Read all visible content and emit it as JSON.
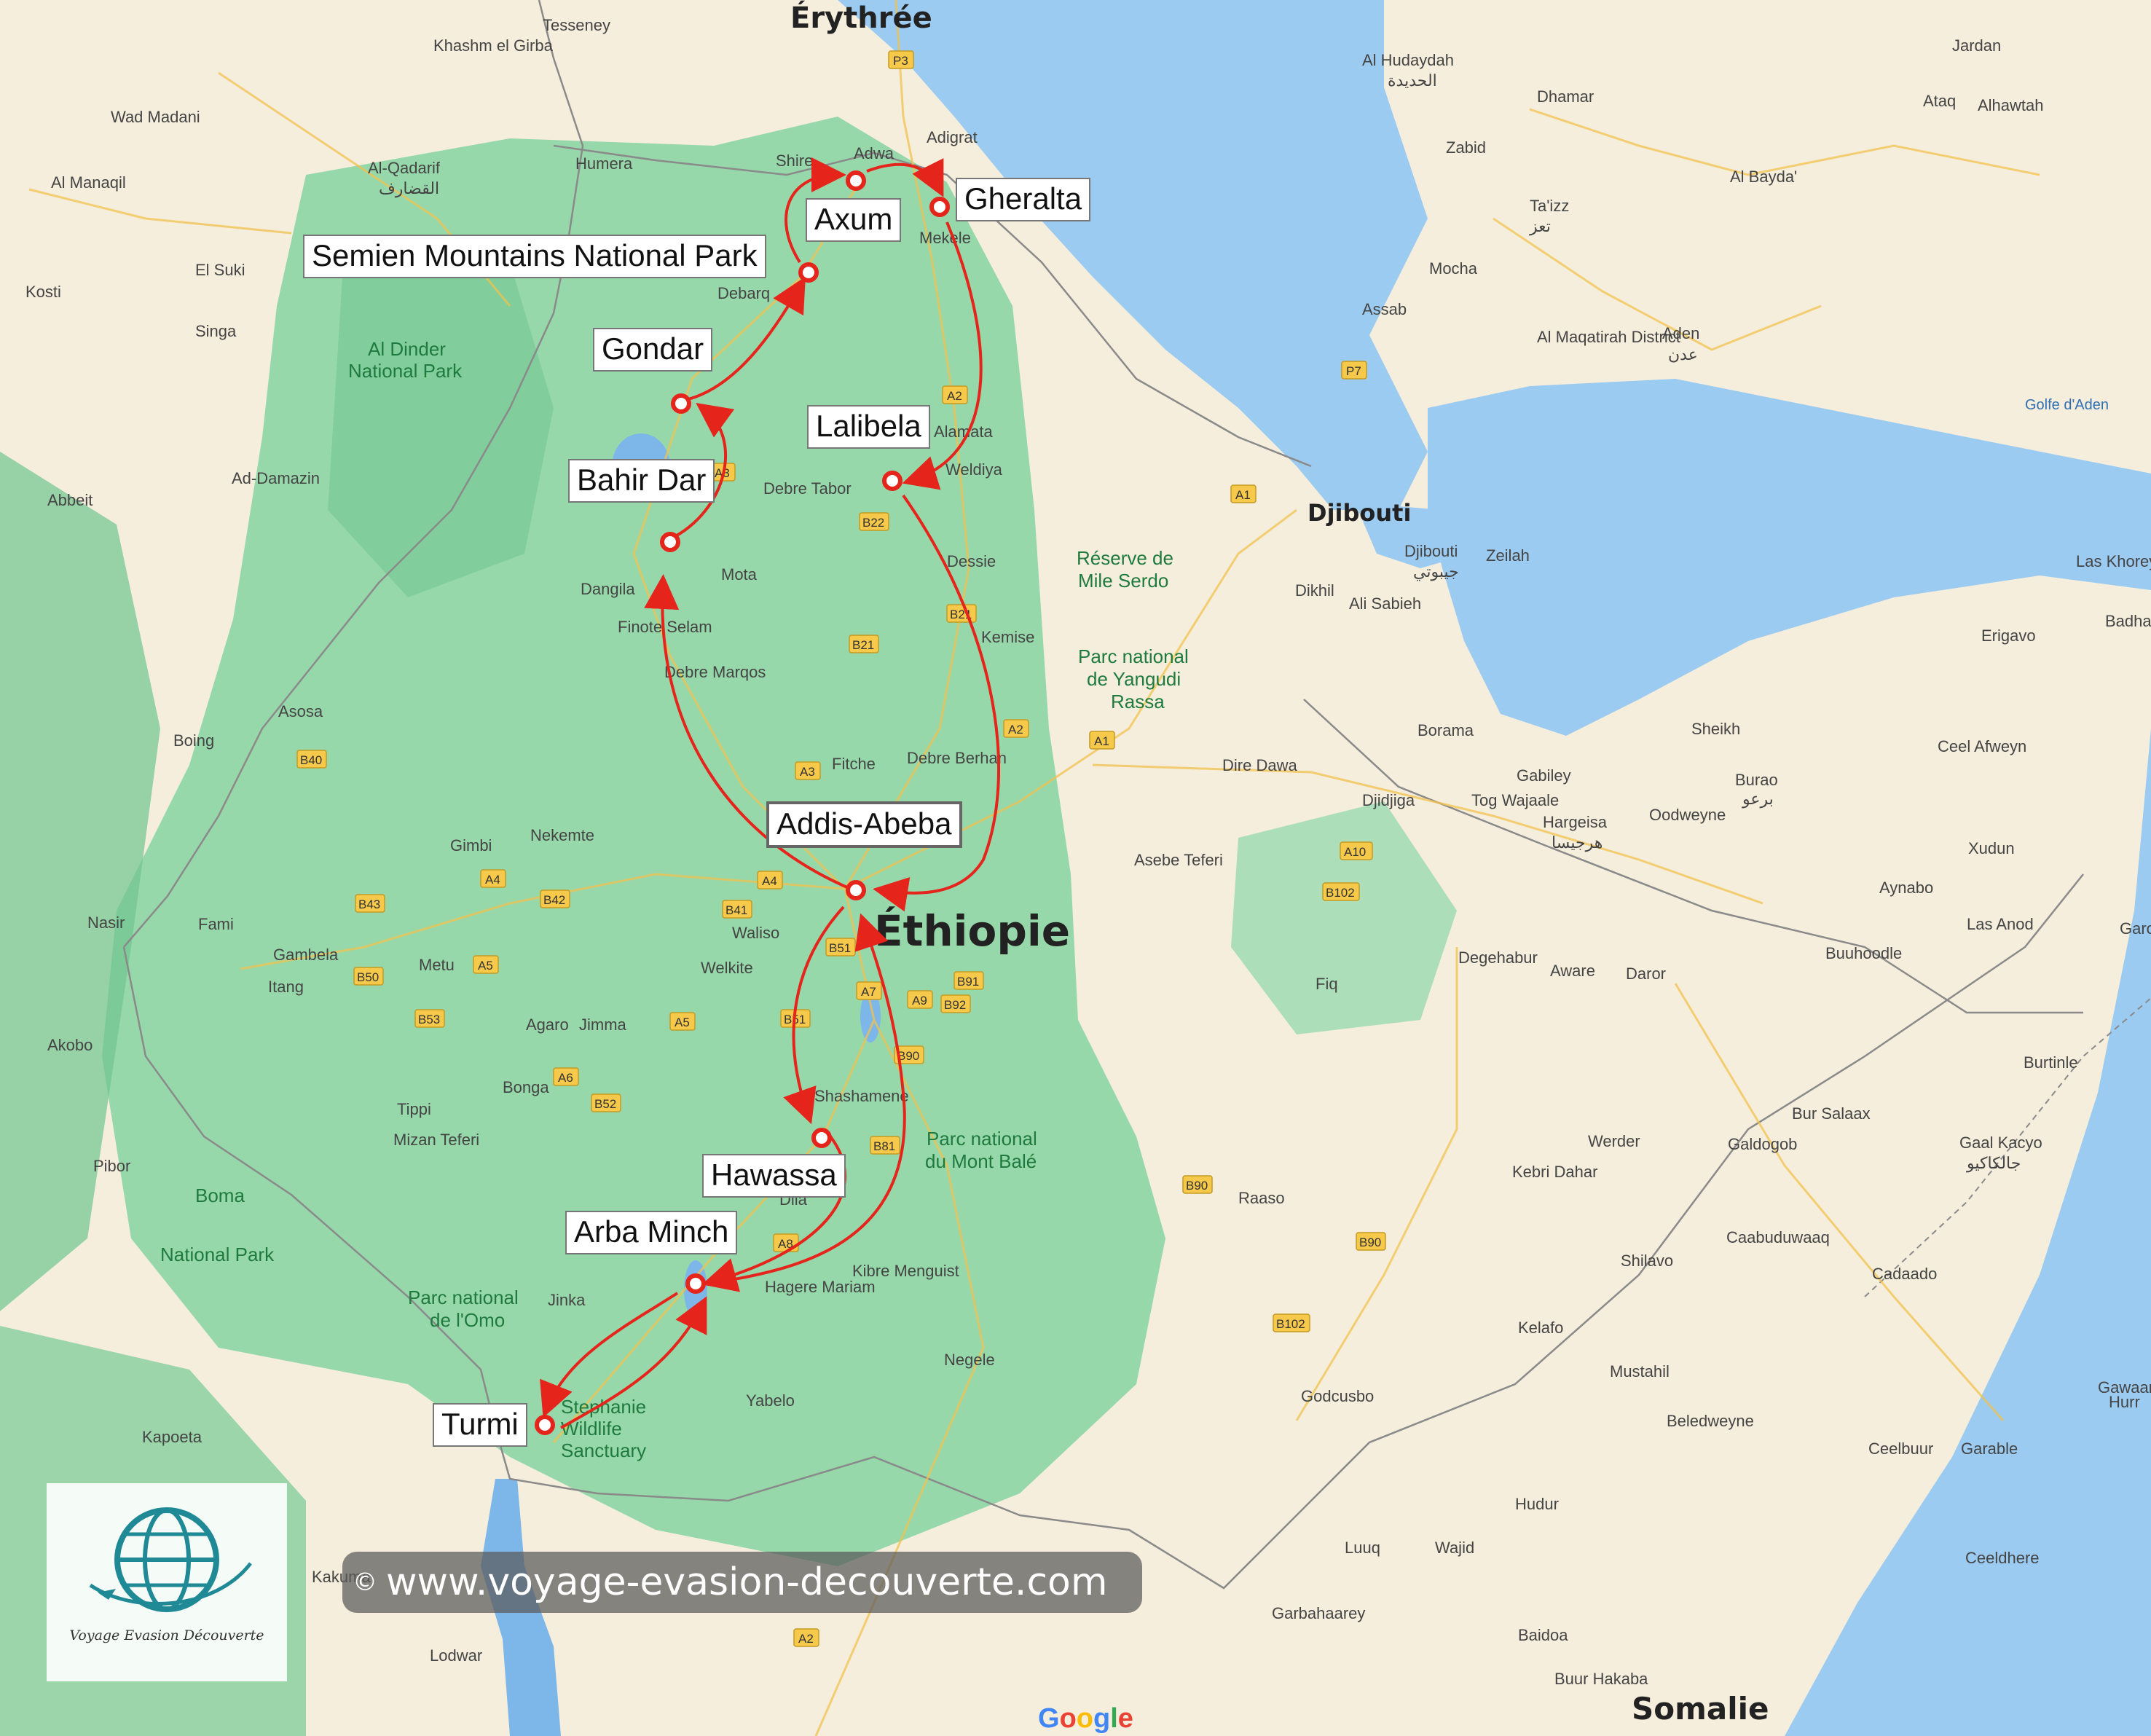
{
  "map": {
    "countries": [
      "Érythrée",
      "Éthiopie",
      "Somalie"
    ],
    "itinerary_stops": [
      "Axum",
      "Gheralta",
      "Semien Mountains National Park",
      "Gondar",
      "Lalibela",
      "Bahir Dar",
      "Addis-Abeba",
      "Hawassa",
      "Arba Minch",
      "Turmi"
    ],
    "places": {
      "djibouti_country": "Djibouti",
      "djibouti_city": "Djibouti",
      "djibouti_city_ar": "جيبوتي",
      "aden": "Aden",
      "aden_ar": "عدن",
      "al_hudaydah": "Al Hudaydah",
      "al_hudaydah_ar": "الحديدة",
      "taizz": "Ta'izz",
      "taizz_ar": "تعز",
      "dhamar": "Dhamar",
      "dhamar_ar": "ذمار",
      "jardan": "Jardan",
      "ataq": "Ataq",
      "al_bayda": "Al Bayda'",
      "alhawtah": "Alhawtah",
      "zabid": "Zabid",
      "mocha": "Mocha",
      "assab": "Assab",
      "al_maqatirah": "Al Maqatirah District",
      "wad_madani": "Wad Madani",
      "al_qadarif": "Al-Qadarif",
      "al_qadarif_ar": "القضارف",
      "al_manaqil": "Al Manaqil",
      "kosti": "Kosti",
      "el_suki": "El Suki",
      "singa": "Singa",
      "ad_damazin": "Ad-Damazin",
      "abbeit": "Abbeit",
      "tesseney": "Tesseney",
      "khashm_el_girba": "Khashm el Girba",
      "shire": "Shire",
      "adwa": "Adwa",
      "adigrat": "Adigrat",
      "humera": "Humera",
      "mekele": "Mekele",
      "debarq": "Debarq",
      "alamata": "Alamata",
      "weldiya": "Weldiya",
      "debre_tabor": "Debre Tabor",
      "dessie": "Dessie",
      "kemise": "Kemise",
      "mota": "Mota",
      "dangila": "Dangila",
      "finote_selam": "Finote Selam",
      "debre_marqos": "Debre Marqos",
      "fitche": "Fitche",
      "debre_berhan": "Debre Berhan",
      "asosa": "Asosa",
      "boing": "Boing",
      "gimbi": "Gimbi",
      "nekemte": "Nekemte",
      "nasir": "Nasir",
      "fami": "Fami",
      "gambela": "Gambela",
      "itang": "Itang",
      "metu": "Metu",
      "agaro": "Agaro",
      "jimma": "Jimma",
      "bonga": "Bonga",
      "tippi": "Tippi",
      "mizan_teferi": "Mizan Teferi",
      "akobo": "Akobo",
      "pibor": "Pibor",
      "waliso": "Waliso",
      "welkite": "Welkite",
      "shashamene": "Shashamene",
      "dila": "Dila",
      "hagere_mariam": "Hagere Mariam",
      "kibre_menguist": "Kibre Menguist",
      "negele": "Negele",
      "yabelo": "Yabelo",
      "jinka": "Jinka",
      "kapoeta": "Kapoeta",
      "kakuma": "Kakuma",
      "lodwar": "Lodwar",
      "dire_dawa": "Dire Dawa",
      "djidjiga": "Djidjiga",
      "asebe_teferi": "Asebe Teferi",
      "dikhil": "Dikhil",
      "ali_sabieh": "Ali Sabieh",
      "zeilah": "Zeilah",
      "borama": "Borama",
      "gabiley": "Gabiley",
      "tog_wajaale": "Tog Wajaale",
      "hargeisa": "Hargeisa",
      "hargeisa_ar": "هرجيسا",
      "sheikh": "Sheikh",
      "burao": "Burao",
      "burao_ar": "برعو",
      "erigavo": "Erigavo",
      "badhan": "Badhan",
      "las_khorey": "Las Khorey",
      "ceel_afweyn": "Ceel Afweyn",
      "oodweyne": "Oodweyne",
      "xudun": "Xudun",
      "aynabo": "Aynabo",
      "las_anod": "Las Anod",
      "buuhoodle": "Buuhoodle",
      "degehabur": "Degehabur",
      "aware": "Aware",
      "daror": "Daror",
      "fiq": "Fiq",
      "burtinle": "Burtinle",
      "bur_salaax": "Bur Salaax",
      "galdogob": "Galdogob",
      "gaal_kacyo": "Gaal Kacyo",
      "gaal_kacyo_ar": "جالكاكيو",
      "werder": "Werder",
      "kebri_dahar": "Kebri Dahar",
      "raaso": "Raaso",
      "shilavo": "Shilavo",
      "cadaado": "Cadaado",
      "caabuduwaaq": "Caabuduwaaq",
      "mustahil": "Mustahil",
      "kelafo": "Kelafo",
      "godcusbo": "Godcusbo",
      "beledweyne": "Beledweyne",
      "ceelbuur": "Ceelbuur",
      "garable": "Garable",
      "hudur": "Hudur",
      "luuq": "Luuq",
      "wajid": "Wajid",
      "ceeldhere": "Ceeldhere",
      "garbahaarey": "Garbahaarey",
      "baidoa": "Baidoa",
      "buur_hakaba": "Buur Hakaba",
      "gawaan": "Gawaan",
      "hurr": "Hurr",
      "garo": "Garo"
    },
    "water": {
      "gulf_of_aden": "Golfe d'Aden"
    },
    "parks": {
      "al_dinder": "Al Dinder National Park",
      "mile_serdo": "Réserve de Mile Serdo",
      "yangudi_rassa": "Parc national de Yangudi Rassa",
      "mont_bale": "Parc national du Mont Balé",
      "boma": "Boma National Park",
      "omo": "Parc national de l'Omo",
      "stephanie": "Stephanie Wildlife Sanctuary"
    },
    "roads": [
      "P3",
      "P7",
      "A1",
      "A2",
      "A3",
      "A4",
      "A5",
      "A6",
      "A7",
      "A8",
      "A9",
      "A10",
      "B21",
      "B22",
      "B40",
      "B41",
      "B42",
      "B43",
      "B50",
      "B51",
      "B52",
      "B53",
      "B81",
      "B90",
      "B91",
      "B92",
      "B102"
    ],
    "colors": {
      "route": "#e5251c",
      "land": "#f5eedc",
      "green": "#7dcf9a",
      "sea": "#9ccbf2"
    }
  },
  "watermark": {
    "copyright": "©",
    "url": "www.voyage-evasion-decouverte.com"
  },
  "logo": {
    "caption": "Voyage Evasion Découverte"
  },
  "attribution": {
    "google": "Google"
  }
}
